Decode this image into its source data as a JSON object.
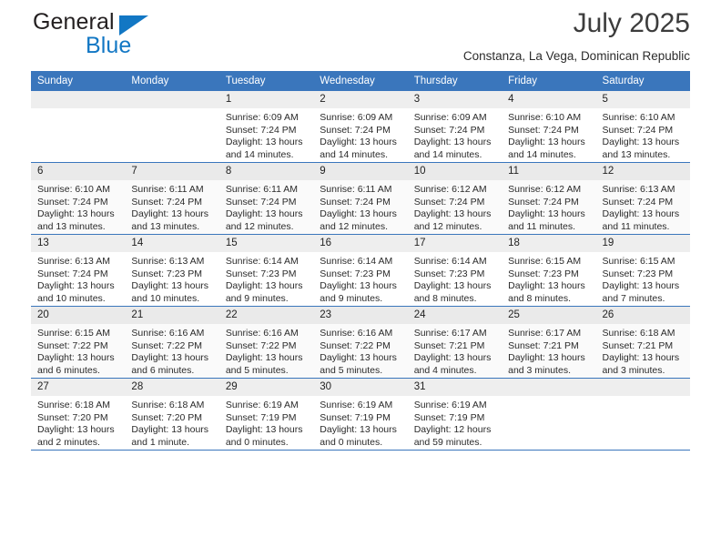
{
  "brand": {
    "name_part1": "General",
    "name_part2": "Blue",
    "logo_icon": "triangle-flag-icon",
    "color_blue": "#1277c4",
    "color_dark": "#231f20"
  },
  "header": {
    "title": "July 2025",
    "subtitle": "Constanza, La Vega, Dominican Republic"
  },
  "calendar": {
    "accent_color": "#3a76bc",
    "daynum_bg": "#eeeeee",
    "weekday_headers": [
      "Sunday",
      "Monday",
      "Tuesday",
      "Wednesday",
      "Thursday",
      "Friday",
      "Saturday"
    ],
    "weeks": [
      [
        {
          "day": "",
          "empty": true
        },
        {
          "day": "",
          "empty": true
        },
        {
          "day": "1",
          "sunrise": "Sunrise: 6:09 AM",
          "sunset": "Sunset: 7:24 PM",
          "daylight": "Daylight: 13 hours and 14 minutes."
        },
        {
          "day": "2",
          "sunrise": "Sunrise: 6:09 AM",
          "sunset": "Sunset: 7:24 PM",
          "daylight": "Daylight: 13 hours and 14 minutes."
        },
        {
          "day": "3",
          "sunrise": "Sunrise: 6:09 AM",
          "sunset": "Sunset: 7:24 PM",
          "daylight": "Daylight: 13 hours and 14 minutes."
        },
        {
          "day": "4",
          "sunrise": "Sunrise: 6:10 AM",
          "sunset": "Sunset: 7:24 PM",
          "daylight": "Daylight: 13 hours and 14 minutes."
        },
        {
          "day": "5",
          "sunrise": "Sunrise: 6:10 AM",
          "sunset": "Sunset: 7:24 PM",
          "daylight": "Daylight: 13 hours and 13 minutes."
        }
      ],
      [
        {
          "day": "6",
          "sunrise": "Sunrise: 6:10 AM",
          "sunset": "Sunset: 7:24 PM",
          "daylight": "Daylight: 13 hours and 13 minutes."
        },
        {
          "day": "7",
          "sunrise": "Sunrise: 6:11 AM",
          "sunset": "Sunset: 7:24 PM",
          "daylight": "Daylight: 13 hours and 13 minutes."
        },
        {
          "day": "8",
          "sunrise": "Sunrise: 6:11 AM",
          "sunset": "Sunset: 7:24 PM",
          "daylight": "Daylight: 13 hours and 12 minutes."
        },
        {
          "day": "9",
          "sunrise": "Sunrise: 6:11 AM",
          "sunset": "Sunset: 7:24 PM",
          "daylight": "Daylight: 13 hours and 12 minutes."
        },
        {
          "day": "10",
          "sunrise": "Sunrise: 6:12 AM",
          "sunset": "Sunset: 7:24 PM",
          "daylight": "Daylight: 13 hours and 12 minutes."
        },
        {
          "day": "11",
          "sunrise": "Sunrise: 6:12 AM",
          "sunset": "Sunset: 7:24 PM",
          "daylight": "Daylight: 13 hours and 11 minutes."
        },
        {
          "day": "12",
          "sunrise": "Sunrise: 6:13 AM",
          "sunset": "Sunset: 7:24 PM",
          "daylight": "Daylight: 13 hours and 11 minutes."
        }
      ],
      [
        {
          "day": "13",
          "sunrise": "Sunrise: 6:13 AM",
          "sunset": "Sunset: 7:24 PM",
          "daylight": "Daylight: 13 hours and 10 minutes."
        },
        {
          "day": "14",
          "sunrise": "Sunrise: 6:13 AM",
          "sunset": "Sunset: 7:23 PM",
          "daylight": "Daylight: 13 hours and 10 minutes."
        },
        {
          "day": "15",
          "sunrise": "Sunrise: 6:14 AM",
          "sunset": "Sunset: 7:23 PM",
          "daylight": "Daylight: 13 hours and 9 minutes."
        },
        {
          "day": "16",
          "sunrise": "Sunrise: 6:14 AM",
          "sunset": "Sunset: 7:23 PM",
          "daylight": "Daylight: 13 hours and 9 minutes."
        },
        {
          "day": "17",
          "sunrise": "Sunrise: 6:14 AM",
          "sunset": "Sunset: 7:23 PM",
          "daylight": "Daylight: 13 hours and 8 minutes."
        },
        {
          "day": "18",
          "sunrise": "Sunrise: 6:15 AM",
          "sunset": "Sunset: 7:23 PM",
          "daylight": "Daylight: 13 hours and 8 minutes."
        },
        {
          "day": "19",
          "sunrise": "Sunrise: 6:15 AM",
          "sunset": "Sunset: 7:23 PM",
          "daylight": "Daylight: 13 hours and 7 minutes."
        }
      ],
      [
        {
          "day": "20",
          "sunrise": "Sunrise: 6:15 AM",
          "sunset": "Sunset: 7:22 PM",
          "daylight": "Daylight: 13 hours and 6 minutes."
        },
        {
          "day": "21",
          "sunrise": "Sunrise: 6:16 AM",
          "sunset": "Sunset: 7:22 PM",
          "daylight": "Daylight: 13 hours and 6 minutes."
        },
        {
          "day": "22",
          "sunrise": "Sunrise: 6:16 AM",
          "sunset": "Sunset: 7:22 PM",
          "daylight": "Daylight: 13 hours and 5 minutes."
        },
        {
          "day": "23",
          "sunrise": "Sunrise: 6:16 AM",
          "sunset": "Sunset: 7:22 PM",
          "daylight": "Daylight: 13 hours and 5 minutes."
        },
        {
          "day": "24",
          "sunrise": "Sunrise: 6:17 AM",
          "sunset": "Sunset: 7:21 PM",
          "daylight": "Daylight: 13 hours and 4 minutes."
        },
        {
          "day": "25",
          "sunrise": "Sunrise: 6:17 AM",
          "sunset": "Sunset: 7:21 PM",
          "daylight": "Daylight: 13 hours and 3 minutes."
        },
        {
          "day": "26",
          "sunrise": "Sunrise: 6:18 AM",
          "sunset": "Sunset: 7:21 PM",
          "daylight": "Daylight: 13 hours and 3 minutes."
        }
      ],
      [
        {
          "day": "27",
          "sunrise": "Sunrise: 6:18 AM",
          "sunset": "Sunset: 7:20 PM",
          "daylight": "Daylight: 13 hours and 2 minutes."
        },
        {
          "day": "28",
          "sunrise": "Sunrise: 6:18 AM",
          "sunset": "Sunset: 7:20 PM",
          "daylight": "Daylight: 13 hours and 1 minute."
        },
        {
          "day": "29",
          "sunrise": "Sunrise: 6:19 AM",
          "sunset": "Sunset: 7:19 PM",
          "daylight": "Daylight: 13 hours and 0 minutes."
        },
        {
          "day": "30",
          "sunrise": "Sunrise: 6:19 AM",
          "sunset": "Sunset: 7:19 PM",
          "daylight": "Daylight: 13 hours and 0 minutes."
        },
        {
          "day": "31",
          "sunrise": "Sunrise: 6:19 AM",
          "sunset": "Sunset: 7:19 PM",
          "daylight": "Daylight: 12 hours and 59 minutes."
        },
        {
          "day": "",
          "empty": true
        },
        {
          "day": "",
          "empty": true
        }
      ]
    ]
  }
}
